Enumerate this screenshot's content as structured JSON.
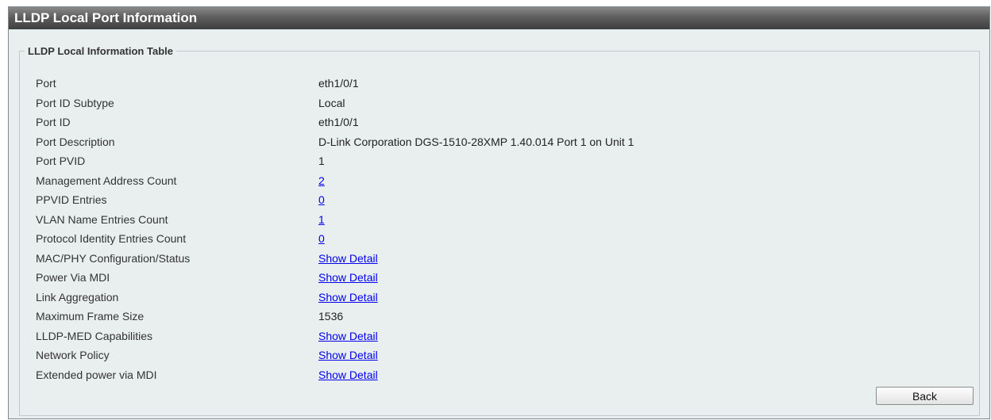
{
  "window": {
    "title": "LLDP Local Port Information"
  },
  "group": {
    "legend": "LLDP Local Information Table"
  },
  "rows": [
    {
      "label": "Port",
      "value": "eth1/0/1",
      "link": false
    },
    {
      "label": "Port ID Subtype",
      "value": "Local",
      "link": false
    },
    {
      "label": "Port ID",
      "value": "eth1/0/1",
      "link": false
    },
    {
      "label": "Port Description",
      "value": "D-Link Corporation DGS-1510-28XMP 1.40.014 Port 1 on Unit 1",
      "link": false
    },
    {
      "label": "Port PVID",
      "value": "1",
      "link": false
    },
    {
      "label": "Management Address Count",
      "value": "2",
      "link": true
    },
    {
      "label": "PPVID Entries",
      "value": "0",
      "link": true
    },
    {
      "label": "VLAN Name Entries Count",
      "value": "1",
      "link": true
    },
    {
      "label": "Protocol Identity Entries Count",
      "value": "0",
      "link": true
    },
    {
      "label": "MAC/PHY Configuration/Status",
      "value": "Show Detail",
      "link": true
    },
    {
      "label": "Power Via MDI",
      "value": "Show Detail",
      "link": true
    },
    {
      "label": "Link Aggregation",
      "value": "Show Detail",
      "link": true
    },
    {
      "label": "Maximum Frame Size",
      "value": "1536",
      "link": false
    },
    {
      "label": "LLDP-MED Capabilities",
      "value": "Show Detail",
      "link": true
    },
    {
      "label": "Network Policy",
      "value": "Show Detail",
      "link": true
    },
    {
      "label": "Extended power via MDI",
      "value": "Show Detail",
      "link": true
    }
  ],
  "buttons": {
    "back_label": "Back"
  },
  "colors": {
    "link": "#0000ee",
    "panel_bg": "#e9efef",
    "title_bar": "#4a4a4a"
  }
}
